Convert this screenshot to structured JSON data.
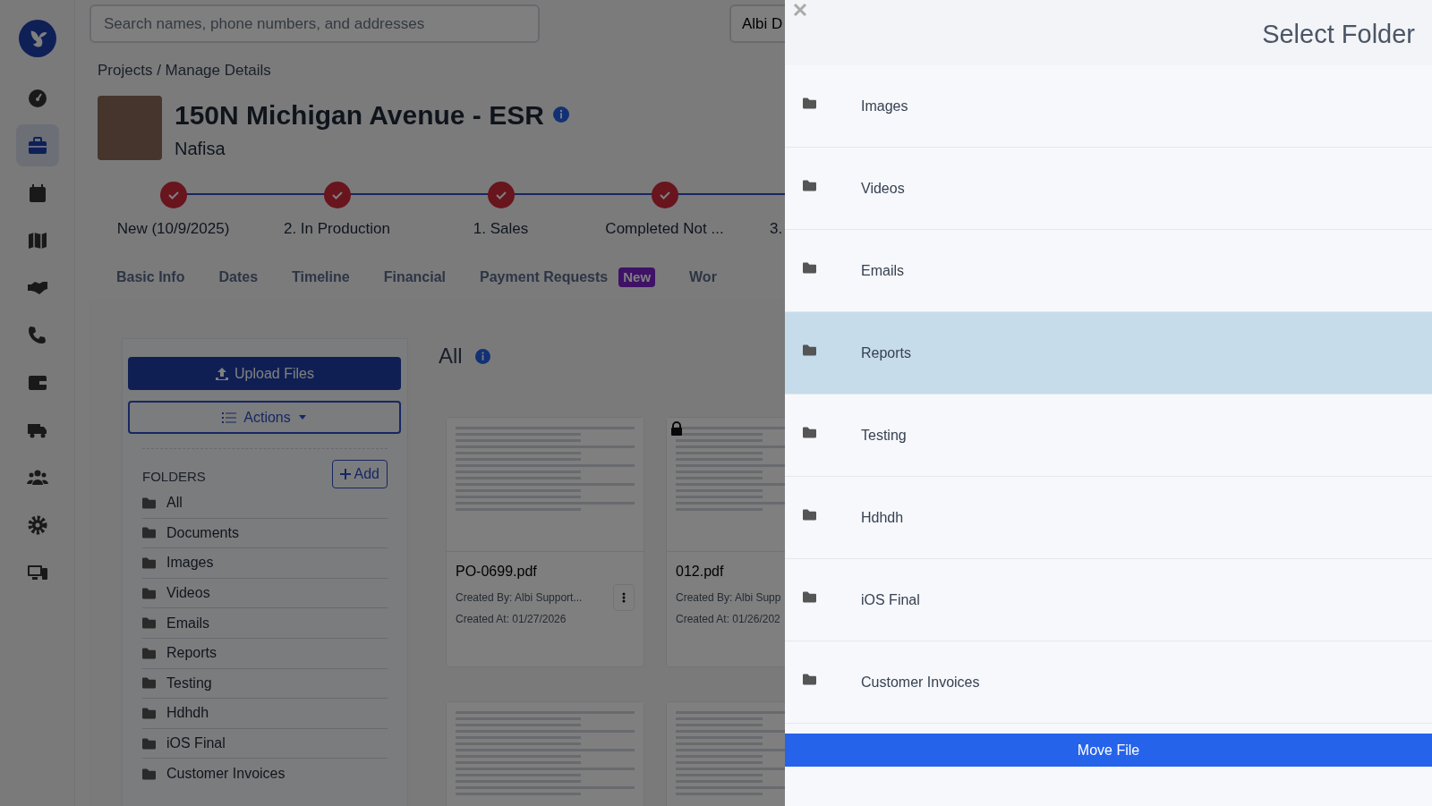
{
  "sidebar": {
    "items": [
      {
        "kind": "dashboard",
        "selected": false
      },
      {
        "kind": "briefcase",
        "selected": true
      },
      {
        "kind": "calendar",
        "selected": false
      },
      {
        "kind": "map",
        "selected": false
      },
      {
        "kind": "handshake",
        "selected": false
      },
      {
        "kind": "phone",
        "selected": false
      },
      {
        "kind": "wallet",
        "selected": false
      },
      {
        "kind": "truck",
        "selected": false
      },
      {
        "kind": "users",
        "selected": false
      },
      {
        "kind": "settings",
        "selected": false
      },
      {
        "kind": "devices",
        "selected": false
      }
    ]
  },
  "search": {
    "placeholder": "Search names, phone numbers, and addresses"
  },
  "user_button": {
    "label": "Albi D"
  },
  "breadcrumb": "Projects / Manage Details",
  "project": {
    "title": "150N Michigan Avenue - ESR",
    "subtitle": "Nafisa"
  },
  "stepper": [
    {
      "label": "New (10/9/2025)"
    },
    {
      "label": "2. In Production"
    },
    {
      "label": "1. Sales"
    },
    {
      "label": "Completed Not ..."
    },
    {
      "label": "3."
    }
  ],
  "tabs": [
    {
      "label": "Basic Info"
    },
    {
      "label": "Dates"
    },
    {
      "label": "Timeline"
    },
    {
      "label": "Financial"
    },
    {
      "label": "Payment Requests",
      "badge": "New"
    },
    {
      "label": "Wor"
    }
  ],
  "files_panel": {
    "upload_button": "Upload Files",
    "actions_button": "Actions",
    "folders_heading": "FOLDERS",
    "add_button": "Add",
    "folders": [
      "All",
      "Documents",
      "Images",
      "Videos",
      "Emails",
      "Reports",
      "Testing",
      "Hdhdh",
      "iOS Final",
      "Customer Invoices"
    ],
    "heading": "All",
    "files": [
      {
        "name": "PO-0699.pdf",
        "created_by": "Created By: Albi Support...",
        "created_at": "Created At: 01/27/2026",
        "locked": false,
        "menu": true
      },
      {
        "name": "012.pdf",
        "created_by": "Created By: Albi Supp",
        "created_at": "Created At: 01/26/202",
        "locked": true,
        "menu": false
      }
    ]
  },
  "drawer": {
    "title": "Select Folder",
    "folders": [
      {
        "name": "Images",
        "selected": false
      },
      {
        "name": "Videos",
        "selected": false
      },
      {
        "name": "Emails",
        "selected": false
      },
      {
        "name": "Reports",
        "selected": true
      },
      {
        "name": "Testing",
        "selected": false
      },
      {
        "name": "Hdhdh",
        "selected": false
      },
      {
        "name": "iOS Final",
        "selected": false
      },
      {
        "name": "Customer Invoices",
        "selected": false
      }
    ],
    "move_button": "Move File"
  }
}
